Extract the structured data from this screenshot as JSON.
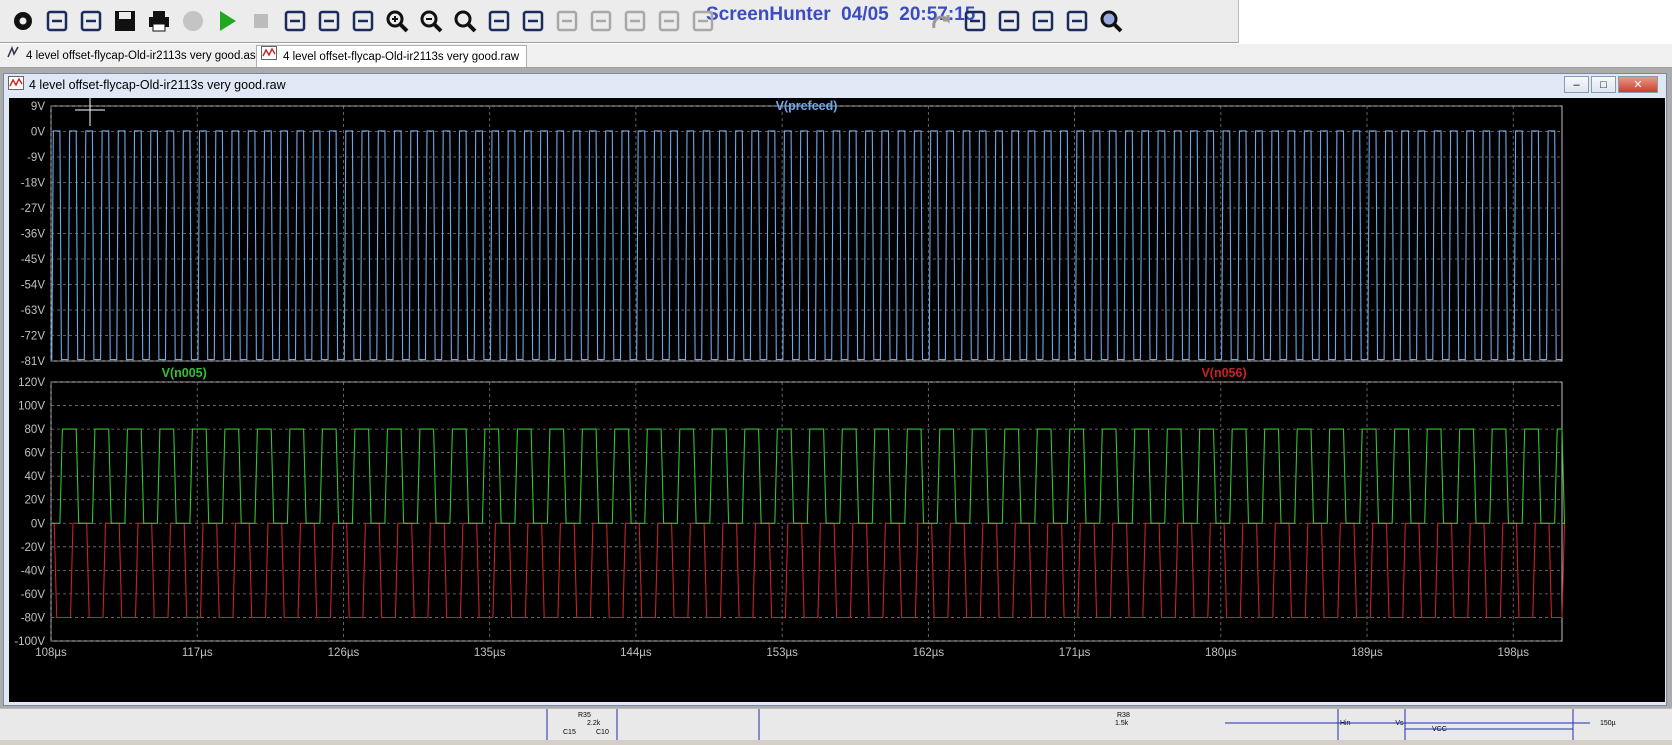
{
  "overlay_title": "ScreenHunter  04/05  20:57:15",
  "toolbar": {
    "icons": [
      "settings-gear-icon",
      "new-schematic-icon",
      "open-folder-icon",
      "save-icon",
      "print-icon",
      "halt-icon",
      "run-icon",
      "stop-icon",
      "tile-vertical-icon",
      "tile-horizontal-icon",
      "cascade-icon",
      "zoom-in-icon",
      "zoom-out-icon",
      "zoom-fit-icon",
      "autorange-icon",
      "waveform-icon",
      "wire-icon",
      "ground-icon",
      "label-icon",
      "resistor-icon",
      "capacitor-icon",
      "inductor-icon",
      "diode-icon",
      "component-icon",
      "move-icon",
      "drag-icon",
      "undo-icon",
      "redo-icon",
      "rotate-icon",
      "mirror-icon",
      "text-icon",
      "spice-directive-icon",
      "find-icon"
    ]
  },
  "tabs": [
    {
      "label": "4 level offset-flycap-Old-ir2113s very good.asc",
      "icon": "schematic-icon"
    },
    {
      "label": "4 level offset-flycap-Old-ir2113s very good.raw",
      "icon": "waveform-icon"
    }
  ],
  "window": {
    "title": "4 level offset-flycap-Old-ir2113s very good.raw",
    "buttons": {
      "minimize": "–",
      "maximize": "□",
      "close": "✕"
    }
  },
  "colors": {
    "plot_bg": "#000000",
    "grid": "#7a7a7a",
    "axis_text": "#c0c0c0",
    "prefeed": "#6fa8e8",
    "n005": "#33c233",
    "n056": "#c82323"
  },
  "chart_data": [
    {
      "type": "line",
      "title": "",
      "series": [
        {
          "name": "V(prefeed)",
          "color": "#6fa8e8",
          "waveform": "square",
          "high": 0.2,
          "low": -80.5,
          "period_us": 1.0,
          "duty": 0.5
        }
      ],
      "y_ticks": [
        "9V",
        "0V",
        "-9V",
        "-18V",
        "-27V",
        "-36V",
        "-45V",
        "-54V",
        "-63V",
        "-72V",
        "-81V"
      ],
      "ylim": [
        -81,
        9
      ],
      "xlim": [
        108,
        201
      ],
      "grid": true
    },
    {
      "type": "line",
      "title": "",
      "series": [
        {
          "name": "V(n005)",
          "color": "#33c233",
          "waveform": "pulse",
          "high": 80,
          "low": 0,
          "period_us": 2.0,
          "duty": 0.5
        },
        {
          "name": "V(n056)",
          "color": "#c82323",
          "waveform": "pulse",
          "high": 0,
          "low": -80,
          "period_us": 2.0,
          "duty": 0.5
        }
      ],
      "y_ticks": [
        "120V",
        "100V",
        "80V",
        "60V",
        "40V",
        "20V",
        "0V",
        "-20V",
        "-40V",
        "-60V",
        "-80V",
        "-100V"
      ],
      "ylim": [
        -100,
        120
      ],
      "x_ticks": [
        "108µs",
        "117µs",
        "126µs",
        "135µs",
        "144µs",
        "153µs",
        "162µs",
        "171µs",
        "180µs",
        "189µs",
        "198µs"
      ],
      "x_tick_values": [
        108,
        117,
        126,
        135,
        144,
        153,
        162,
        171,
        180,
        189,
        198
      ],
      "xlim": [
        108,
        201
      ],
      "grid": true
    }
  ],
  "schematic_strip": {
    "labels": [
      "R35",
      "2.2k",
      "C15",
      "C10",
      "R38",
      "1.5k",
      "Hin",
      "-Vs",
      "VCC",
      "150µ"
    ]
  }
}
